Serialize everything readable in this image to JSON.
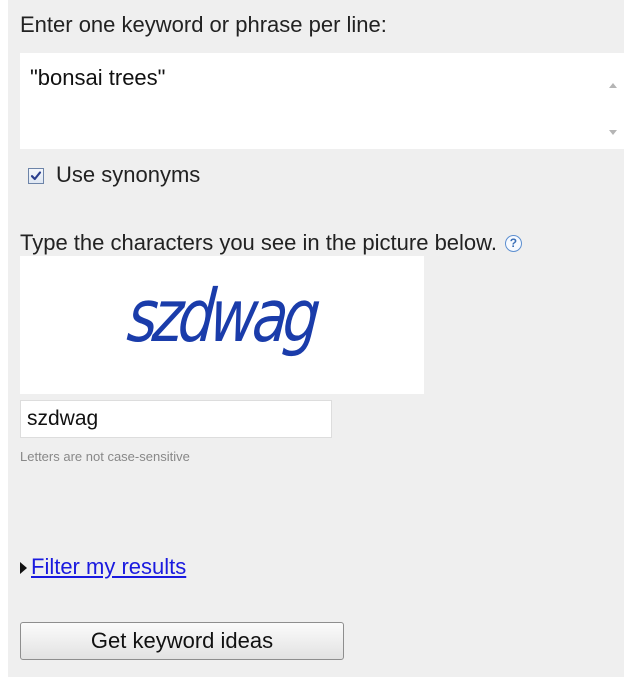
{
  "keywords": {
    "heading": "Enter one keyword or phrase per line:",
    "value": "\"bonsai trees\""
  },
  "synonyms": {
    "label": "Use synonyms",
    "checked": true
  },
  "captcha": {
    "instruction": "Type the characters you see in the picture below.",
    "help_icon": "?",
    "image_text": "szdwag",
    "input_value": "szdwag",
    "note": "Letters are not case-sensitive"
  },
  "filter": {
    "link_label": "Filter my results"
  },
  "actions": {
    "get_ideas_label": "Get keyword ideas"
  },
  "colors": {
    "panel_background": "#efefef",
    "link": "#1a1adf",
    "captcha_text": "#1a3caa"
  }
}
